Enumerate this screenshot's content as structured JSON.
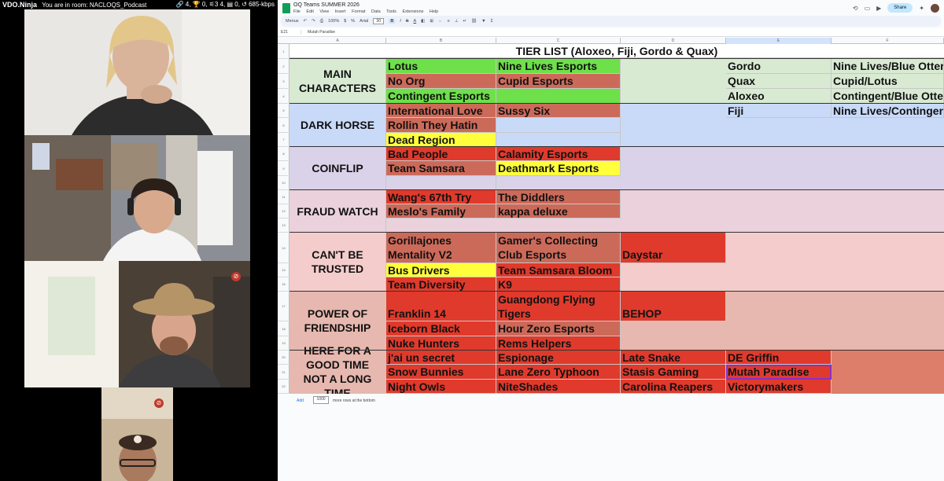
{
  "vdo": {
    "brand": "VDO.Ninja",
    "room": "You are in room: NACLOQS_Podcast",
    "stats": "🔗 4, 🏆 0, ⚟3 4, ▤ 0, ↺ 685-kbps",
    "mute_glyph": "⊘"
  },
  "sheets": {
    "doc_title": "OQ Teams SUMMER 2026",
    "menus": [
      "File",
      "Edit",
      "View",
      "Insert",
      "Format",
      "Data",
      "Tools",
      "Extensions",
      "Help"
    ],
    "share_label": "Share",
    "toolbar": {
      "menus_label": "Menus",
      "zoom": "100%",
      "font": "Arial",
      "font_size": "30",
      "bold": "B",
      "italic": "I",
      "strike": "S",
      "underline_a": "A"
    },
    "cell_ref": "E21",
    "formula_value": "Mutah Paradise",
    "columns": [
      "A",
      "B",
      "C",
      "D",
      "E",
      "F"
    ],
    "rows": [
      "1",
      "2",
      "3",
      "4",
      "5",
      "6",
      "7",
      "8",
      "9",
      "10",
      "11",
      "12",
      "13",
      "14",
      "15",
      "16",
      "17",
      "18",
      "19",
      "20",
      "21",
      "22"
    ],
    "title": "TIER LIST (Aloxeo, Fiji, Gordo & Quax)",
    "tiers": {
      "t1": "MAIN CHARACTERS",
      "t2": "DARK HORSE",
      "t3": "COINFLIP",
      "t4": "FRAUD WATCH",
      "t5": "CAN'T BE TRUSTED",
      "t6": "POWER OF FRIENDSHIP",
      "t7": "HERE FOR A GOOD TIME NOT A LONG TIME"
    },
    "cells": {
      "r2b": "Lotus",
      "r2c": "Nine Lives Esports",
      "r2e": "Gordo",
      "r2f": "Nine Lives/Blue Otter",
      "r3b": "No Org",
      "r3c": "Cupid Esports",
      "r3e": "Quax",
      "r3f": "Cupid/Lotus",
      "r4b": "Contingent Esports",
      "r4e": "Aloxeo",
      "r4f": "Contingent/Blue Otter",
      "r5b": "International Love",
      "r5c": "Sussy Six",
      "r5e": "Fiji",
      "r5f": "Nine Lives/Contingent",
      "r6b": "Rollin They Hatin",
      "r7b": "Dead Region",
      "r8b": "Bad People",
      "r8c": "Calamity Esports",
      "r9b": "Team Samsara",
      "r9c": "Deathmark Esports",
      "r11b": "Wang's 67th Try",
      "r11c": "The Diddlers",
      "r12b": "Meslo's Family",
      "r12c": "kappa deluxe",
      "r14b1": "Gorillajones",
      "r14b2": "Mentality V2",
      "r14c1": "Gamer's Collecting",
      "r14c2": "Club Esports",
      "r14d": "Daystar",
      "r15b": "Bus Drivers",
      "r15c": "Team Samsara Bloom",
      "r16b": "Team Diversity",
      "r16c": "K9",
      "r17b": "Franklin 14",
      "r17c1": "Guangdong Flying",
      "r17c2": "Tigers",
      "r17d": "BEHOP",
      "r18b": "Iceborn Black",
      "r18c": "Hour Zero Esports",
      "r19b": "Nuke Hunters",
      "r19c": "Rems Helpers",
      "r20b": "j'ai un secret",
      "r20c": "Espionage",
      "r20d": "Late Snake",
      "r20e": "DE Griffin",
      "r21b": "Snow Bunnies",
      "r21c": "Lane Zero Typhoon",
      "r21d": "Stasis Gaming",
      "r21e": "Mutah Paradise",
      "r22b": "Night Owls",
      "r22c": "NiteShades",
      "r22d": "Carolina Reapers",
      "r22e": "Victorymakers"
    },
    "footer": {
      "add_label": "Add",
      "rows_count": "1000",
      "rows_text": "more rows at the bottom"
    }
  }
}
